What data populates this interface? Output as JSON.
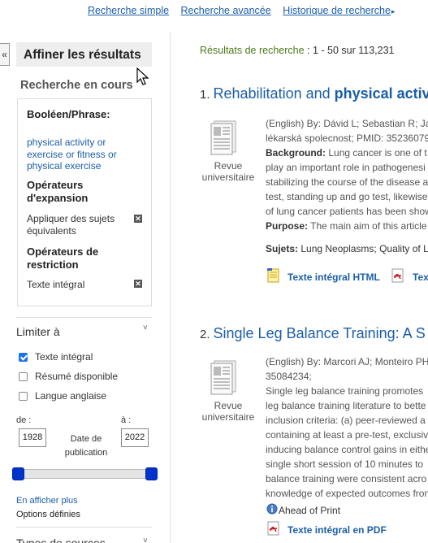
{
  "top_links": {
    "simple": "Recherche simple",
    "advanced": "Recherche avancée",
    "history": "Historique de recherche",
    "history_arrow": "▸"
  },
  "sidebar": {
    "collapse_glyph": "«",
    "refine_title": "Affiner les résultats",
    "current_search_title": "Recherche en cours",
    "boolean_label": "Booléen/Phrase:",
    "boolean_value_lines": [
      "physical activity or",
      "exercise or fitness or",
      "physical exercise"
    ],
    "expanders_label_lines": [
      "Opérateurs",
      "d'expansion"
    ],
    "expander_value_lines": [
      "Appliquer des sujets",
      "équivalents"
    ],
    "limiters_label_lines": [
      "Opérateurs de",
      "restriction"
    ],
    "limiter_value": "Texte intégral",
    "remove_glyph": "✕",
    "limit_title": "Limiter à",
    "chevron": "˅",
    "checkboxes": [
      {
        "label": "Texte intégral",
        "checked": true
      },
      {
        "label": "Résumé disponible",
        "checked": false
      },
      {
        "label": "Langue anglaise",
        "checked": false
      }
    ],
    "date_from_label": "de :",
    "date_to_label": "à :",
    "date_from": "1928",
    "date_to": "2022",
    "date_center_lines": [
      "Date de",
      "publication"
    ],
    "slider_color": "#0033cc",
    "show_more": "En afficher plus",
    "options_set": "Options définies",
    "source_types_title": "Types de sources"
  },
  "results": {
    "count_label": "Résultats de recherche",
    "count_value": ": 1 - 50 sur 113,231",
    "items": [
      {
        "number": "1.",
        "title_plain": "Rehabilitation and ",
        "title_bold": "physical activ",
        "type_lines": [
          "Revue",
          "universitaire"
        ],
        "meta_lines": [
          "(English) By: Dávid L; Sebastian R; Ja",
          "lékarská spolecnost; PMID: 35236079;"
        ],
        "abstract_label": "Background:",
        "abstract_lines": [
          " Lung cancer is one of t",
          "play an important role in pathogenesi",
          "stabilizing the course of the disease a",
          "test, standing up and go test, likewise",
          "of lung cancer patients has been show"
        ],
        "purpose_label": "Purpose:",
        "purpose_text": " The main aim of this article",
        "subjects_label": "Sujets:",
        "subjects_text": " Lung Neoplasms; Quality of L",
        "link_html": "Texte intégral HTML",
        "link_pdf_partial": "Tex"
      },
      {
        "number": "2.",
        "title_plain": "Single Leg Balance Training: A S",
        "type_lines": [
          "Revue",
          "universitaire"
        ],
        "meta_lines": [
          "(English) By: Marcori AJ; Monteiro PH",
          "35084234;"
        ],
        "abstract_lines": [
          "Single leg balance training promotes",
          "leg balance training literature to bette",
          "inclusion criteria: (a) peer-reviewed a",
          "containing at least a pre-test, exclusiv",
          "inducing balance control gains in eithe",
          "single short session of 10 minutes to",
          "balance training were consistent acro",
          "knowledge of expected outcomes fron"
        ],
        "ahead": "Ahead of Print",
        "link_pdf": "Texte intégral en PDF"
      }
    ]
  }
}
